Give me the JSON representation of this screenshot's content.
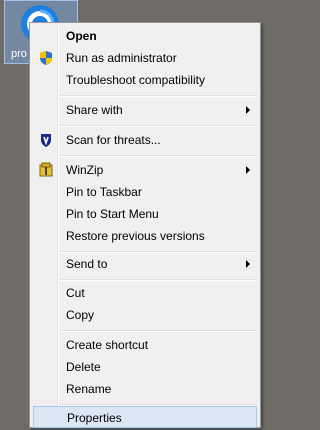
{
  "desktop": {
    "icon_caption": "pro"
  },
  "menu": {
    "items": [
      {
        "label": "Open",
        "icon": "",
        "submenu": false
      },
      {
        "label": "Run as administrator",
        "icon": "shield-icon",
        "submenu": false
      },
      {
        "label": "Troubleshoot compatibility",
        "icon": "",
        "submenu": false
      },
      {
        "label": "Share with",
        "icon": "",
        "submenu": true
      },
      {
        "label": "Scan for threats...",
        "icon": "antivirus-icon",
        "submenu": false
      },
      {
        "label": "WinZip",
        "icon": "winzip-icon",
        "submenu": true
      },
      {
        "label": "Pin to Taskbar",
        "icon": "",
        "submenu": false
      },
      {
        "label": "Pin to Start Menu",
        "icon": "",
        "submenu": false
      },
      {
        "label": "Restore previous versions",
        "icon": "",
        "submenu": false
      },
      {
        "label": "Send to",
        "icon": "",
        "submenu": true
      },
      {
        "label": "Cut",
        "icon": "",
        "submenu": false
      },
      {
        "label": "Copy",
        "icon": "",
        "submenu": false
      },
      {
        "label": "Create shortcut",
        "icon": "",
        "submenu": false
      },
      {
        "label": "Delete",
        "icon": "",
        "submenu": false
      },
      {
        "label": "Rename",
        "icon": "",
        "submenu": false
      },
      {
        "label": "Properties",
        "icon": "",
        "submenu": false,
        "highlighted": true
      }
    ]
  }
}
